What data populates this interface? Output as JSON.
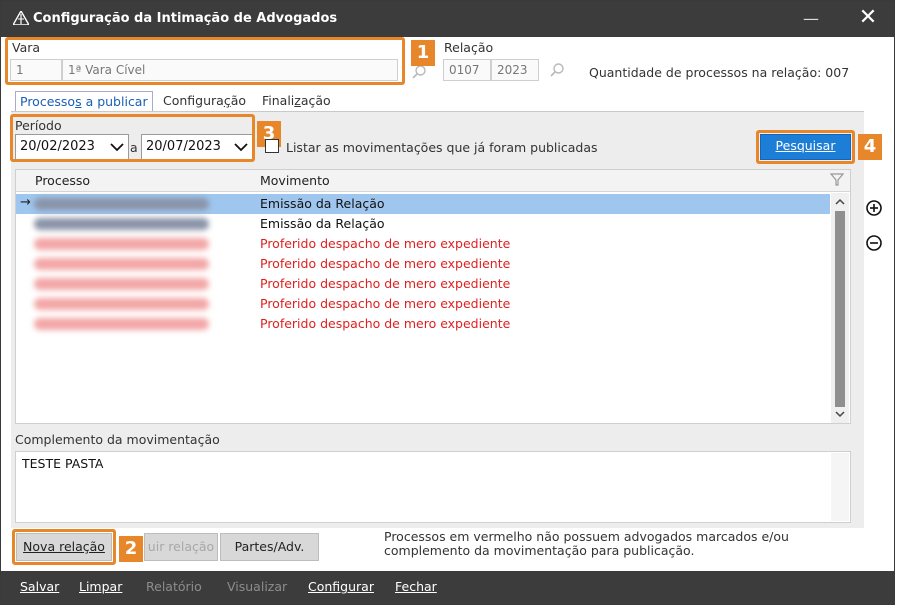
{
  "window": {
    "title": "Configuração da Intimação de Advogados",
    "minimize": "—",
    "close": "✕"
  },
  "vara": {
    "label": "Vara",
    "code": "1",
    "name": "1ª Vara Cível"
  },
  "relacao": {
    "label": "Relação",
    "number": "0107",
    "year": "2023",
    "quantity_text": "Quantidade de processos na relação: 007"
  },
  "tabs": [
    {
      "pre": "Processo",
      "ul": "s",
      "post": " a publicar"
    },
    {
      "pre": "Configura",
      "ul": "ç",
      "post": "ão"
    },
    {
      "pre": "Finali",
      "ul": "z",
      "post": "ação"
    }
  ],
  "periodo": {
    "label": "Período",
    "from": "20/02/2023",
    "sep": "a",
    "to": "20/07/2023"
  },
  "listar_checkbox": {
    "label": "Listar as movimentações que já foram publicadas"
  },
  "pesquisar_button": "Pesquisar",
  "callouts": [
    "1",
    "2",
    "3",
    "4"
  ],
  "grid": {
    "columns": [
      "Processo",
      "Movimento"
    ],
    "rows": [
      {
        "movement": "Emissão da Relação",
        "color": "#111111",
        "selected": true
      },
      {
        "movement": "Emissão da Relação",
        "color": "#111111",
        "selected": false
      },
      {
        "movement": "Proferido despacho de mero expediente",
        "color": "#e02020",
        "selected": false
      },
      {
        "movement": "Proferido despacho de mero expediente",
        "color": "#e02020",
        "selected": false
      },
      {
        "movement": "Proferido despacho de mero expediente",
        "color": "#e02020",
        "selected": false
      },
      {
        "movement": "Proferido despacho de mero expediente",
        "color": "#e02020",
        "selected": false
      },
      {
        "movement": "Proferido despacho de mero expediente",
        "color": "#e02020",
        "selected": false
      }
    ]
  },
  "complemento": {
    "label": "Complemento da movimentação",
    "value": "TESTE PASTA"
  },
  "buttons": {
    "nova_relacao": "Nova relação",
    "excluir_relacao": "uir relação",
    "partes": "Partes/Adv."
  },
  "note": {
    "line1": "Processos em vermelho não possuem advogados marcados e/ou",
    "line2": "complemento da movimentação para publicação."
  },
  "bottom_menu": [
    {
      "label": "Salvar",
      "disabled": false
    },
    {
      "label": "Limpar",
      "disabled": false
    },
    {
      "label": "Relatório",
      "disabled": true
    },
    {
      "label": "Visualizar",
      "disabled": true
    },
    {
      "label": "Configurar",
      "disabled": false
    },
    {
      "label": "Fechar",
      "disabled": false
    }
  ],
  "colors": {
    "accent": "#e8872a",
    "primary": "#1c7ed6",
    "error": "#e02020",
    "selected_row": "#9fc6ee"
  }
}
